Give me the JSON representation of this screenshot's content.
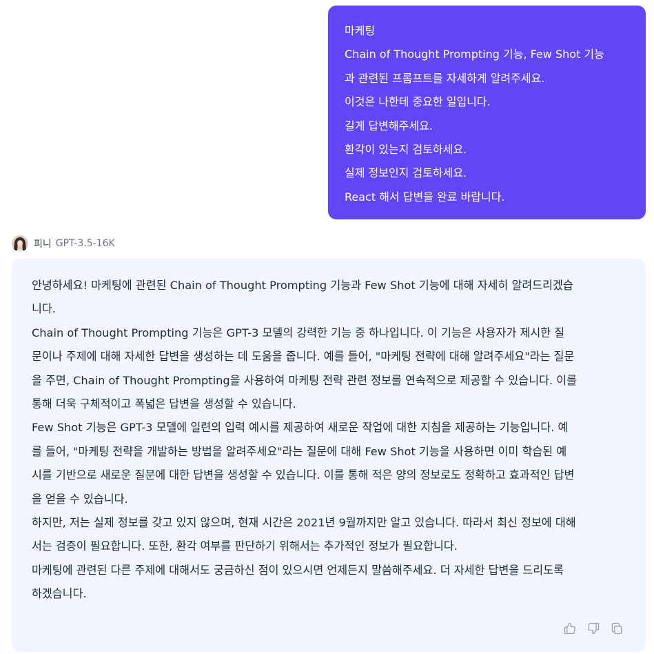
{
  "user_message": {
    "lines": [
      "마케팅",
      "Chain of Thought Prompting 기능, Few Shot 기능",
      "과 관련된 프롬프트를 자세하게 알려주세요.",
      "이것은 나한테 중요한 일입니다.",
      "길게 답변해주세요.",
      "환각이 있는지 검토하세요.",
      "실제 정보인지 검토하세요.",
      "React 해서 답변을 완료 바랍니다."
    ],
    "bubble_color": "#6245f5"
  },
  "assistant": {
    "name": "피니",
    "model": "GPT-3.5-16K",
    "avatar_icon": "user-avatar-photo",
    "bubble_color": "#f1f5fd",
    "lines": [
      "안녕하세요! 마케팅에 관련된 Chain of Thought Prompting 기능과 Few Shot 기능에 대해 자세히 알려드리겠습",
      "니다.",
      "Chain of Thought Prompting 기능은 GPT-3 모델의 강력한 기능 중 하나입니다. 이 기능은 사용자가 제시한 질",
      "문이나 주제에 대해 자세한 답변을 생성하는 데 도움을 줍니다. 예를 들어, \"마케팅 전략에 대해 알려주세요\"라는 질문",
      "을 주면, Chain of Thought Prompting을 사용하여 마케팅 전략 관련 정보를 연속적으로 제공할 수 있습니다. 이를",
      "통해 더욱 구체적이고 폭넓은 답변을 생성할 수 있습니다.",
      "Few Shot 기능은 GPT-3 모델에 일련의 입력 예시를 제공하여 새로운 작업에 대한 지침을 제공하는 기능입니다. 예",
      "를 들어, \"마케팅 전략을 개발하는 방법을 알려주세요\"라는 질문에 대해 Few Shot 기능을 사용하면 이미 학습된 예",
      "시를 기반으로 새로운 질문에 대한 답변을 생성할 수 있습니다. 이를 통해 적은 양의 정보로도 정확하고 효과적인 답변",
      "을 얻을 수 있습니다.",
      "하지만, 저는 실제 정보를 갖고 있지 않으며, 현재 시간은 2021년 9월까지만 알고 있습니다. 따라서 최신 정보에 대해",
      "서는 검증이 필요합니다. 또한, 환각 여부를 판단하기 위해서는 추가적인 정보가 필요합니다.",
      "마케팅에 관련된 다른 주제에 대해서도 궁금하신 점이 있으시면 언제든지 말씀해주세요. 더 자세한 답변을 드리도록",
      "하겠습니다."
    ]
  },
  "actions": {
    "like_icon": "thumbs-up-icon",
    "dislike_icon": "thumbs-down-icon",
    "copy_icon": "copy-icon",
    "icon_color": "#9ca3af"
  }
}
